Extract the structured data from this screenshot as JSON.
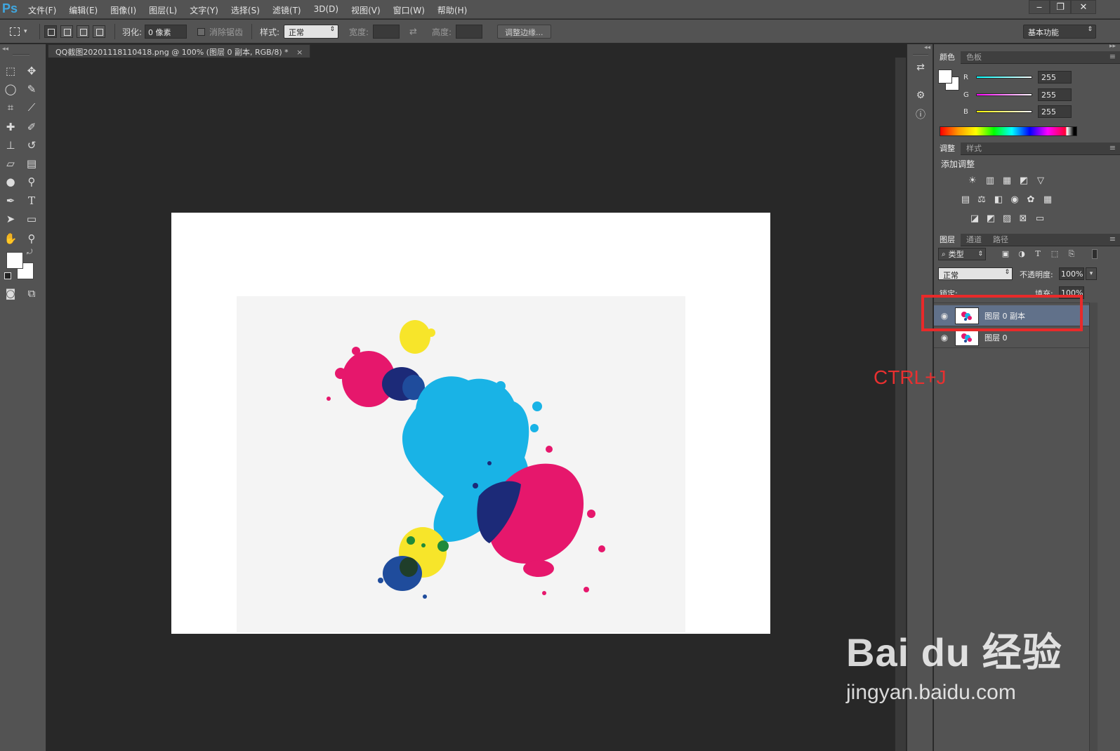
{
  "app": {
    "logo": "Ps"
  },
  "menu": [
    "文件(F)",
    "编辑(E)",
    "图像(I)",
    "图层(L)",
    "文字(Y)",
    "选择(S)",
    "滤镜(T)",
    "3D(D)",
    "视图(V)",
    "窗口(W)",
    "帮助(H)"
  ],
  "window_controls": {
    "minimize": "‒",
    "restore": "❐",
    "close": "✕"
  },
  "options": {
    "feather_label": "羽化:",
    "feather_value": "0 像素",
    "antialias_label": "消除锯齿",
    "style_label": "样式:",
    "style_value": "正常",
    "width_label": "宽度:",
    "swap_icon": "⇄",
    "height_label": "高度:",
    "refine_button": "调整边缘...",
    "workspace": "基本功能"
  },
  "document": {
    "tab_title": "QQ截图20201118110418.png @ 100% (图层 0 副本, RGB/8) *",
    "close": "×"
  },
  "tools": [
    "marquee-icon",
    "move-icon",
    "lasso-icon",
    "quick-select-icon",
    "crop-icon",
    "eyedropper-icon",
    "healing-icon",
    "brush-icon",
    "stamp-icon",
    "history-brush-icon",
    "eraser-icon",
    "gradient-icon",
    "blur-icon",
    "dodge-icon",
    "pen-icon",
    "type-icon",
    "path-select-icon",
    "shape-icon",
    "hand-icon",
    "zoom-icon",
    "quickmask-icon",
    "screenmode-icon"
  ],
  "color_panel": {
    "tabs": [
      "颜色",
      "色板"
    ],
    "r_label": "R",
    "r_value": "255",
    "g_label": "G",
    "g_value": "255",
    "b_label": "B",
    "b_value": "255"
  },
  "adjust_panel": {
    "tabs": [
      "调整",
      "样式"
    ],
    "title": "添加调整"
  },
  "layers_panel": {
    "tabs": [
      "图层",
      "通道",
      "路径"
    ],
    "filter_kind": "类型",
    "blend_mode": "正常",
    "opacity_label": "不透明度:",
    "opacity_value": "100%",
    "lock_label": "锁定:",
    "fill_label": "填充:",
    "fill_value": "100%",
    "layers": [
      {
        "name": "图层 0 副本",
        "visible": true,
        "selected": true
      },
      {
        "name": "图层 0",
        "visible": true,
        "selected": false
      }
    ]
  },
  "annotation": {
    "shortcut": "CTRL+J",
    "highlight_color": "#e82a2a"
  },
  "watermark": {
    "logo": "Bai du 经验",
    "url": "jingyan.baidu.com"
  },
  "colors": {
    "cyan": "#19b3e6",
    "magenta": "#e6176c",
    "yellow": "#f7e52a",
    "navy": "#1c2a78",
    "blue": "#1f4c9c",
    "green": "#1f8a3a"
  }
}
